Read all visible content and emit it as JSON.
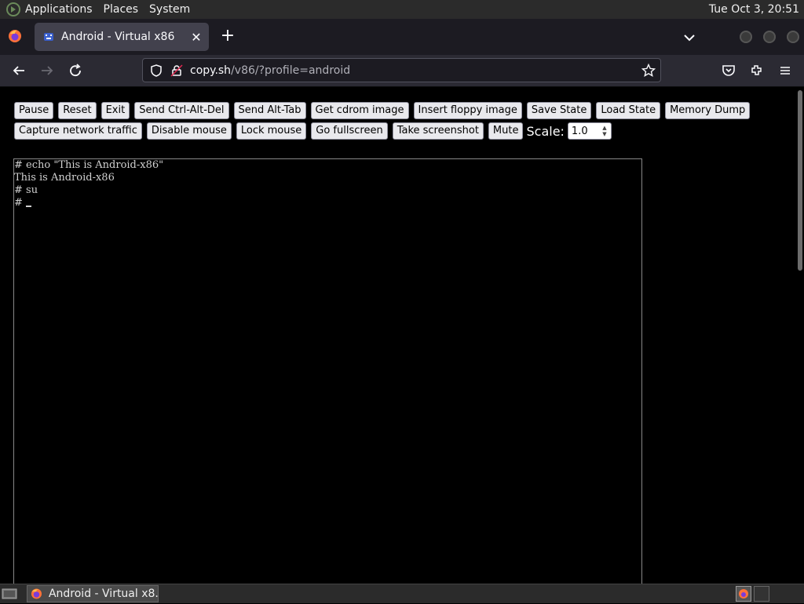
{
  "system_panel": {
    "menus": [
      "Applications",
      "Places",
      "System"
    ],
    "clock": "Tue Oct  3, 20:51"
  },
  "browser": {
    "tab": {
      "title": "Android - Virtual x86",
      "close": "✕"
    },
    "new_tab": "+",
    "url": {
      "host": "copy.sh",
      "path": "/v86/?profile=android"
    }
  },
  "controls": {
    "row1": [
      "Pause",
      "Reset",
      "Exit",
      "Send Ctrl-Alt-Del",
      "Send Alt-Tab",
      "Get cdrom image",
      "Insert floppy image",
      "Save State",
      "Load State",
      "Memory Dump"
    ],
    "row2": [
      "Capture network traffic",
      "Disable mouse",
      "Lock mouse",
      "Go fullscreen",
      "Take screenshot",
      "Mute"
    ],
    "scale_label": "Scale:",
    "scale_value": "1.0"
  },
  "terminal": {
    "lines": [
      "# echo \"This is Android-x86\"",
      "This is Android-x86",
      "# su",
      "# "
    ]
  },
  "taskbar": {
    "window_label": "Android - Virtual x8..."
  }
}
